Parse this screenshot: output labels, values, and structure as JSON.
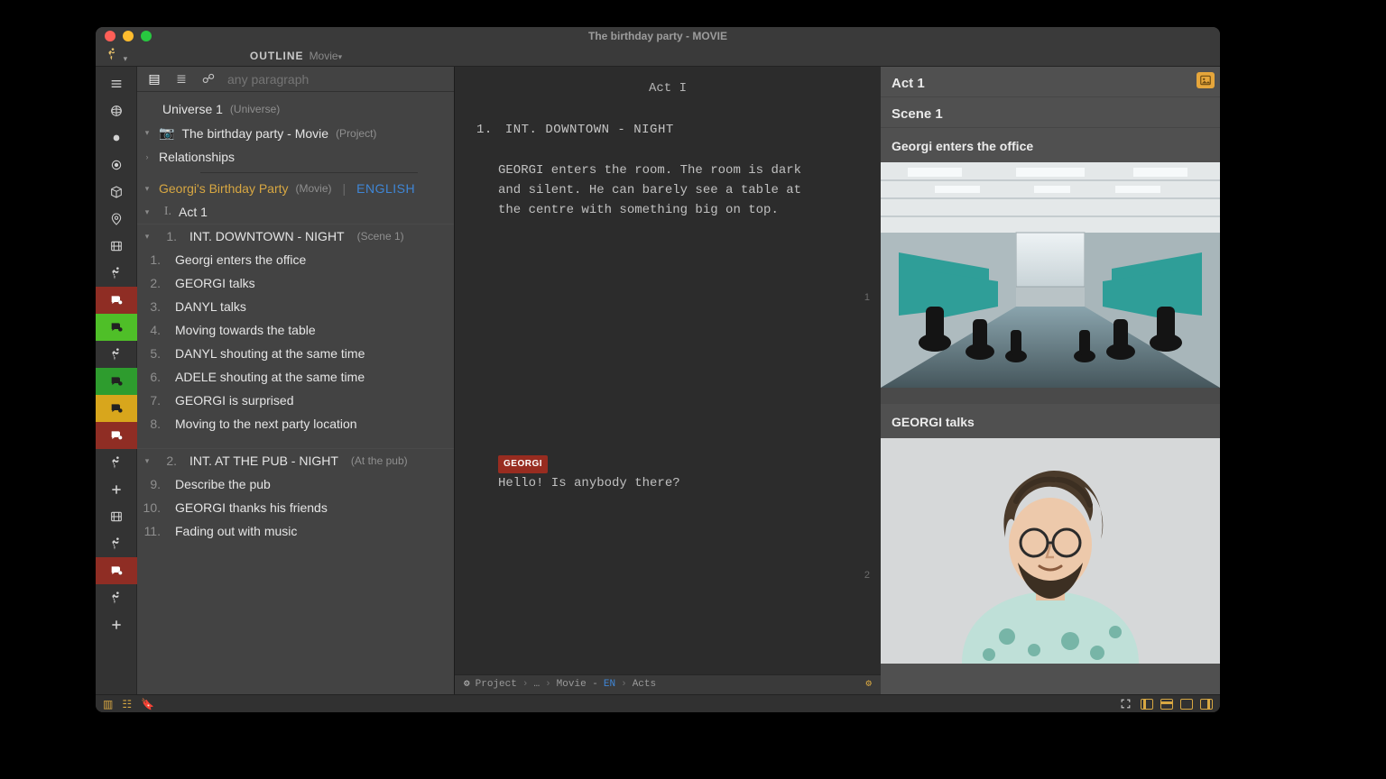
{
  "window_title": "The birthday party - MOVIE",
  "header": {
    "outline_label": "OUTLINE",
    "movie_label": "Movie"
  },
  "search": {
    "placeholder": "any paragraph"
  },
  "tree": {
    "universe": {
      "title": "Universe 1",
      "subtitle": "(Universe)"
    },
    "project": {
      "title": "The birthday party - Movie",
      "subtitle": "(Project)"
    },
    "relationships": "Relationships",
    "movie": {
      "title": "Georgi's Birthday Party",
      "subtitle": "(Movie)",
      "lang": "ENGLISH",
      "pipe": "|"
    },
    "act1": {
      "roman": "I.",
      "title": "Act 1"
    },
    "scenes": [
      {
        "num": "1.",
        "slug": "INT.  DOWNTOWN - NIGHT",
        "paren": "(Scene 1)",
        "beats": [
          {
            "n": "1.",
            "t": "Georgi enters the office"
          },
          {
            "n": "2.",
            "t": "GEORGI talks"
          },
          {
            "n": "3.",
            "t": "DANYL talks"
          },
          {
            "n": "4.",
            "t": "Moving towards the table"
          },
          {
            "n": "5.",
            "t": "DANYL shouting at the same time"
          },
          {
            "n": "6.",
            "t": "ADELE shouting at the same time"
          },
          {
            "n": "7.",
            "t": "GEORGI is surprised"
          },
          {
            "n": "8.",
            "t": "Moving to the next party location"
          }
        ]
      },
      {
        "num": "2.",
        "slug": "INT.  AT THE PUB - NIGHT",
        "paren": "(At the pub)",
        "beats": [
          {
            "n": "9.",
            "t": "Describe the pub"
          },
          {
            "n": "10.",
            "t": "GEORGI thanks his friends"
          },
          {
            "n": "11.",
            "t": "Fading out with music"
          }
        ]
      }
    ]
  },
  "script": {
    "act_heading": "Act I",
    "slug_num": "1.",
    "slug": "INT. DOWNTOWN - NIGHT",
    "action": "GEORGI enters the room. The room is dark and silent. He can barely see a table at the centre with something big on top.",
    "cue": "GEORGI",
    "dialog": "Hello! Is anybody there?",
    "page_numbers": [
      "1",
      "2"
    ]
  },
  "breadcrumb": {
    "items": [
      "Project",
      "…",
      "Movie -",
      "EN",
      "Acts"
    ],
    "sep": "›"
  },
  "cards": {
    "act": "Act 1",
    "scene": "Scene 1",
    "items": [
      {
        "caption": "Georgi enters the office"
      },
      {
        "caption": "GEORGI talks"
      }
    ]
  },
  "rail": [
    {
      "name": "menu-lines-icon",
      "glyph": "lines",
      "color": "",
      "interact": true
    },
    {
      "name": "globe-icon",
      "glyph": "globe",
      "color": "",
      "interact": true
    },
    {
      "name": "dot-icon",
      "glyph": "dot",
      "color": "",
      "interact": true
    },
    {
      "name": "target-icon",
      "glyph": "target",
      "color": "",
      "interact": true
    },
    {
      "name": "cube-icon",
      "glyph": "cube",
      "color": "",
      "interact": true
    },
    {
      "name": "pin-icon",
      "glyph": "pin",
      "color": "",
      "interact": true
    },
    {
      "name": "film-icon",
      "glyph": "film",
      "color": "",
      "interact": true
    },
    {
      "name": "action-icon-1",
      "glyph": "run",
      "color": "",
      "interact": true
    },
    {
      "name": "dialog-red-1",
      "glyph": "bubble",
      "color": "red",
      "interact": true
    },
    {
      "name": "dialog-green-1",
      "glyph": "bubble",
      "color": "green",
      "interact": true
    },
    {
      "name": "action-icon-2",
      "glyph": "run",
      "color": "",
      "interact": true
    },
    {
      "name": "dialog-green-2",
      "glyph": "bubble",
      "color": "greenb",
      "interact": true
    },
    {
      "name": "dialog-yellow",
      "glyph": "bubble",
      "color": "yellow",
      "interact": true
    },
    {
      "name": "dialog-red-2",
      "glyph": "bubble",
      "color": "red",
      "interact": true
    },
    {
      "name": "action-icon-3",
      "glyph": "run",
      "color": "",
      "interact": true
    },
    {
      "name": "add-icon-1",
      "glyph": "plus",
      "color": "",
      "interact": true
    },
    {
      "name": "film-icon-2",
      "glyph": "film",
      "color": "",
      "interact": true
    },
    {
      "name": "action-icon-4",
      "glyph": "run",
      "color": "",
      "interact": true
    },
    {
      "name": "dialog-red-3",
      "glyph": "bubble",
      "color": "red",
      "interact": true
    },
    {
      "name": "action-icon-5",
      "glyph": "run",
      "color": "",
      "interact": true
    },
    {
      "name": "add-icon-2",
      "glyph": "plus",
      "color": "",
      "interact": true
    }
  ],
  "corner_badge": "image-icon"
}
